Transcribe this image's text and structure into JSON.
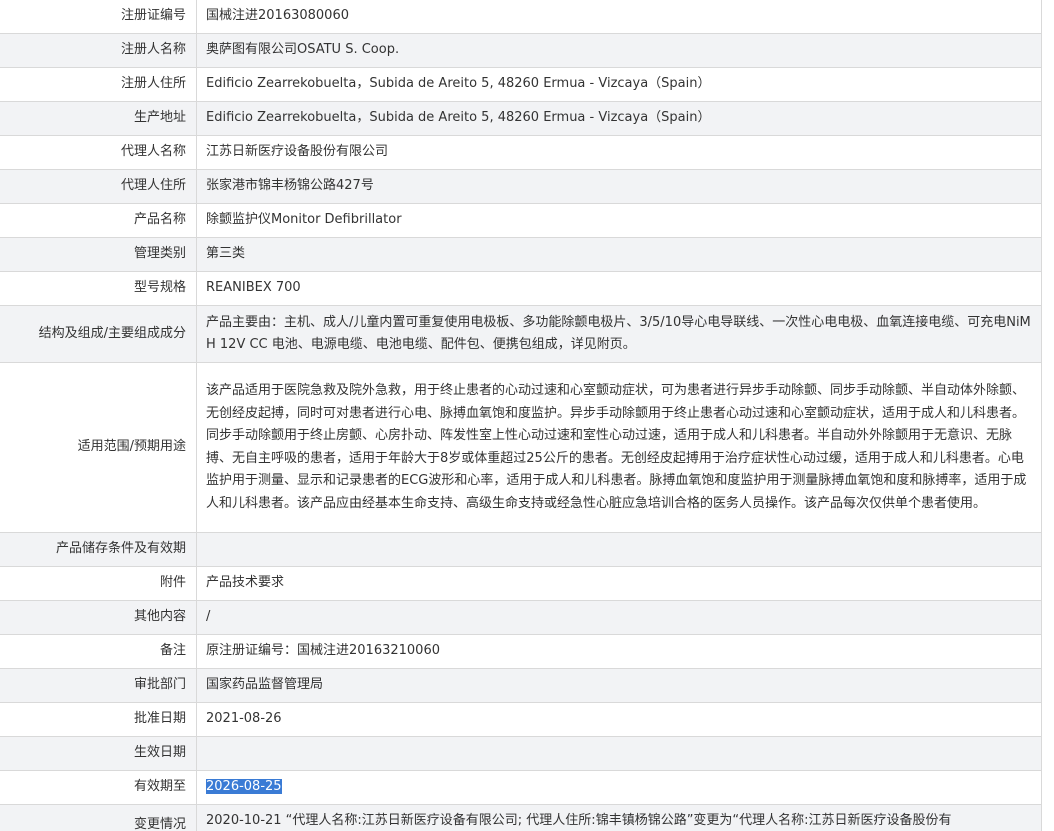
{
  "rows": [
    {
      "label": "注册证编号",
      "value": "国械注进20163080060"
    },
    {
      "label": "注册人名称",
      "value": "奥萨图有限公司OSATU S. Coop."
    },
    {
      "label": "注册人住所",
      "value": "Edificio Zearrekobuelta，Subida de Areito 5, 48260 Ermua - Vizcaya（Spain）"
    },
    {
      "label": "生产地址",
      "value": "Edificio Zearrekobuelta，Subida de Areito 5, 48260 Ermua - Vizcaya（Spain）"
    },
    {
      "label": "代理人名称",
      "value": "江苏日新医疗设备股份有限公司"
    },
    {
      "label": "代理人住所",
      "value": "张家港市锦丰杨锦公路427号"
    },
    {
      "label": "产品名称",
      "value": "除颤监护仪Monitor Defibrillator"
    },
    {
      "label": "管理类别",
      "value": "第三类"
    },
    {
      "label": "型号规格",
      "value": "REANIBEX 700"
    },
    {
      "label": "结构及组成/主要组成成分",
      "value": "产品主要由：主机、成人/儿童内置可重复使用电极板、多功能除颤电极片、3/5/10导心电导联线、一次性心电电极、血氧连接电缆、可充电NiMH 12V CC 电池、电源电缆、电池电缆、配件包、便携包组成，详见附页。"
    },
    {
      "label": "适用范围/预期用途",
      "value": "该产品适用于医院急救及院外急救，用于终止患者的心动过速和心室颤动症状，可为患者进行异步手动除颤、同步手动除颤、半自动体外除颤、无创经皮起搏，同时可对患者进行心电、脉搏血氧饱和度监护。异步手动除颤用于终止患者心动过速和心室颤动症状，适用于成人和儿科患者。同步手动除颤用于终止房颤、心房扑动、阵发性室上性心动过速和室性心动过速，适用于成人和儿科患者。半自动外外除颤用于无意识、无脉搏、无自主呼吸的患者，适用于年龄大于8岁或体重超过25公斤的患者。无创经皮起搏用于治疗症状性心动过缓，适用于成人和儿科患者。心电监护用于测量、显示和记录患者的ECG波形和心率，适用于成人和儿科患者。脉搏血氧饱和度监护用于测量脉搏血氧饱和度和脉搏率，适用于成人和儿科患者。该产品应由经基本生命支持、高级生命支持或经急性心脏应急培训合格的医务人员操作。该产品每次仅供单个患者使用。"
    },
    {
      "label": "产品储存条件及有效期",
      "value": ""
    },
    {
      "label": "附件",
      "value": "产品技术要求"
    },
    {
      "label": "其他内容",
      "value": "/"
    },
    {
      "label": "备注",
      "value": "原注册证编号：国械注进20163210060"
    },
    {
      "label": "审批部门",
      "value": "国家药品监督管理局"
    },
    {
      "label": "批准日期",
      "value": "2021-08-26"
    },
    {
      "label": "生效日期",
      "value": ""
    },
    {
      "label": "有效期至",
      "value": "2026-08-25"
    },
    {
      "label": "变更情况",
      "value": "2020-10-21 “代理人名称:江苏日新医疗设备有限公司; 代理人住所:锦丰镇杨锦公路”变更为“代理人名称:江苏日新医疗设备股份有"
    }
  ]
}
